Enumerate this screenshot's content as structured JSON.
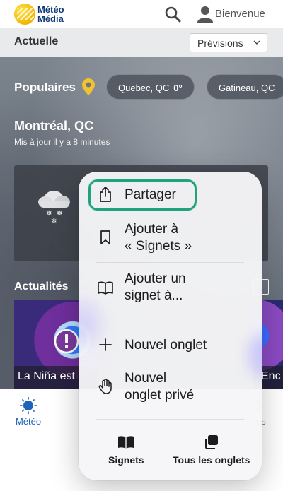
{
  "header": {
    "logo_line1": "Météo",
    "logo_line2": "Média",
    "welcome": "Bienvenue"
  },
  "subheader": {
    "title": "Actuelle",
    "forecast_select": "Prévisions"
  },
  "popular": {
    "label": "Populaires",
    "chips": [
      {
        "city": "Quebec, QC",
        "temp": "0°"
      },
      {
        "city": "Gatineau, QC",
        "temp": ""
      }
    ]
  },
  "location": {
    "city": "Montréal, QC",
    "updated": "Mis à jour il y a 8 minutes"
  },
  "news": {
    "title": "Actualités",
    "items": [
      {
        "caption": "La Niña est"
      },
      {
        "caption": "Enc"
      }
    ]
  },
  "tabbar": {
    "meteo": "Météo",
    "right_fragment": "os"
  },
  "context_menu": {
    "items": [
      {
        "icon": "share-icon",
        "label": "Partager"
      },
      {
        "icon": "bookmark-icon",
        "label_line1": "Ajouter à",
        "label_line2": "« Signets »"
      },
      {
        "icon": "book-open-icon",
        "label_line1": "Ajouter un",
        "label_line2": "signet à..."
      },
      {
        "icon": "plus-icon",
        "label": "Nouvel onglet"
      },
      {
        "icon": "hand-icon",
        "label_line1": "Nouvel",
        "label_line2": "onglet privé"
      }
    ],
    "bottom": [
      {
        "icon": "bookmarks-book-icon",
        "label": "Signets"
      },
      {
        "icon": "tabs-icon",
        "label": "Tous les onglets"
      }
    ],
    "highlight_color": "#1fa37d"
  }
}
